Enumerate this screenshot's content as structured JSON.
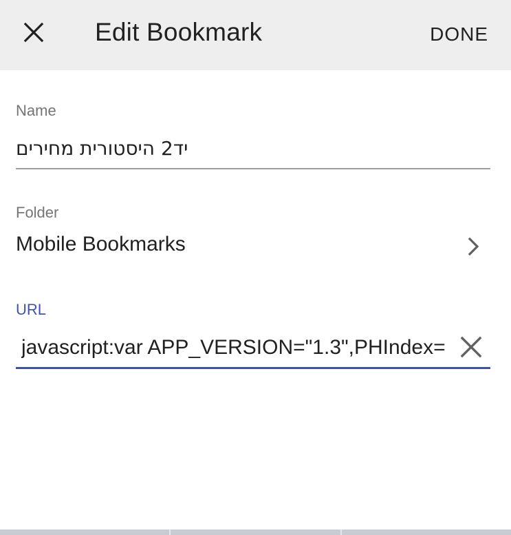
{
  "toolbar": {
    "title": "Edit Bookmark",
    "done_label": "DONE",
    "close_icon": "close-icon"
  },
  "form": {
    "name": {
      "label": "Name",
      "value": "יד2 היסטורית מחירים"
    },
    "folder": {
      "label": "Folder",
      "value": "Mobile Bookmarks",
      "icon": "chevron-right-icon"
    },
    "url": {
      "label": "URL",
      "value": "javascript:var APP_VERSION=\"1.3\",PHIndex=",
      "clear_icon": "clear-icon"
    }
  },
  "colors": {
    "toolbar_bg": "#eeeeee",
    "accent": "#3f51b5",
    "label": "#757575",
    "text": "#212121"
  }
}
